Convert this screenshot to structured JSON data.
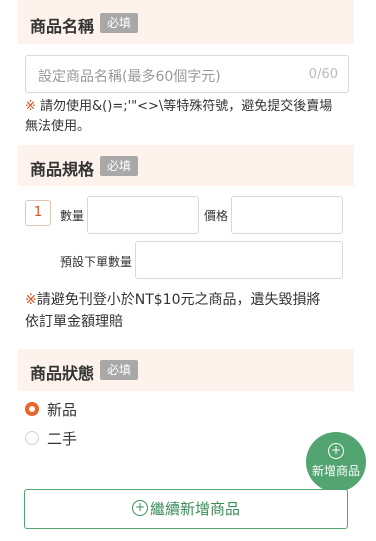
{
  "name_section": {
    "title": "商品名稱",
    "required_badge": "必填",
    "input_placeholder": "設定商品名稱(最多60個字元)",
    "counter": "0/60",
    "warning_mark": "※",
    "warning_line1": " 請勿使用&()=;'\"<>\\等特殊符號，避免提交後賣場",
    "warning_line2": "無法使用。"
  },
  "spec_section": {
    "title": "商品規格",
    "required_badge": "必填",
    "index": "1",
    "quantity_label": "數量",
    "price_label": "價格",
    "default_order_label": "預設下單數量",
    "warning_mark": "※",
    "warning_line1": "請避免刊登小於NT$10元之商品，遺失毀損將",
    "warning_line2": "依訂單金額理賠"
  },
  "condition_section": {
    "title": "商品狀態",
    "required_badge": "必填",
    "options": [
      {
        "label": "新品",
        "selected": true
      },
      {
        "label": "二手",
        "selected": false
      }
    ]
  },
  "fab": {
    "icon": "plus-circle-icon",
    "symbol": "+",
    "label": "新增商品"
  },
  "continue_button": {
    "icon": "plus-circle-icon",
    "symbol": "+",
    "label": "繼續新增商品"
  },
  "colors": {
    "accent_orange": "#e8652b",
    "green": "#52a571",
    "band_bg": "#fdf3ec"
  }
}
